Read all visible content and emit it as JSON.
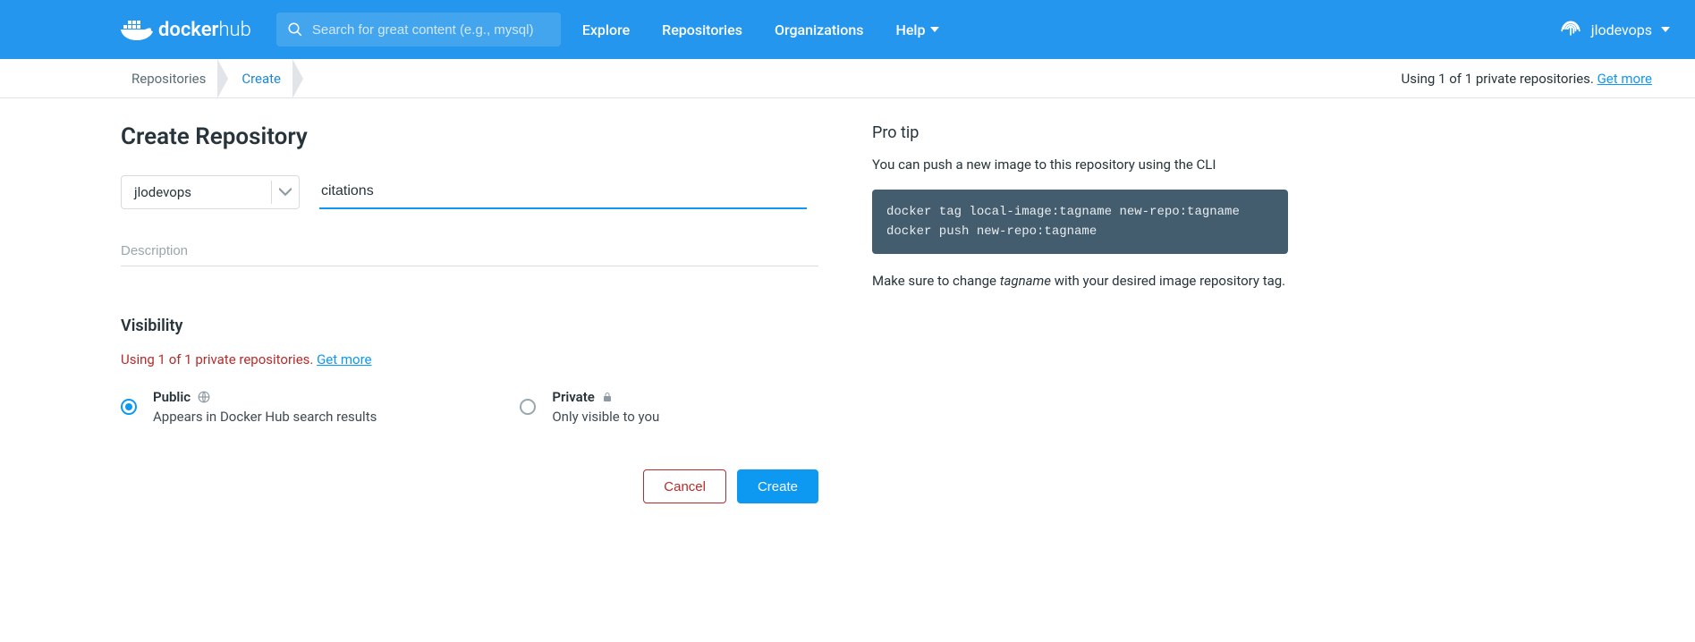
{
  "header": {
    "logo_primary": "docker",
    "logo_secondary": "hub",
    "search_placeholder": "Search for great content (e.g., mysql)",
    "nav": {
      "explore": "Explore",
      "repositories": "Repositories",
      "organizations": "Organizations",
      "help": "Help"
    },
    "username": "jlodevops"
  },
  "breadcrumb": {
    "repositories": "Repositories",
    "create": "Create",
    "quota_text": "Using 1 of 1 private repositories. ",
    "quota_link": "Get more"
  },
  "form": {
    "title": "Create Repository",
    "namespace": "jlodevops",
    "name_value": "citations",
    "description_placeholder": "Description",
    "visibility_heading": "Visibility",
    "quota_text": "Using 1 of 1 private repositories. ",
    "quota_link": "Get more",
    "public": {
      "label": "Public",
      "desc": "Appears in Docker Hub search results"
    },
    "private": {
      "label": "Private",
      "desc": "Only visible to you"
    },
    "cancel": "Cancel",
    "create": "Create"
  },
  "protip": {
    "heading": "Pro tip",
    "intro": "You can push a new image to this repository using the CLI",
    "code": "docker tag local-image:tagname new-repo:tagname\ndocker push new-repo:tagname",
    "note_pre": "Make sure to change ",
    "note_em": "tagname",
    "note_post": " with your desired image repository tag."
  }
}
